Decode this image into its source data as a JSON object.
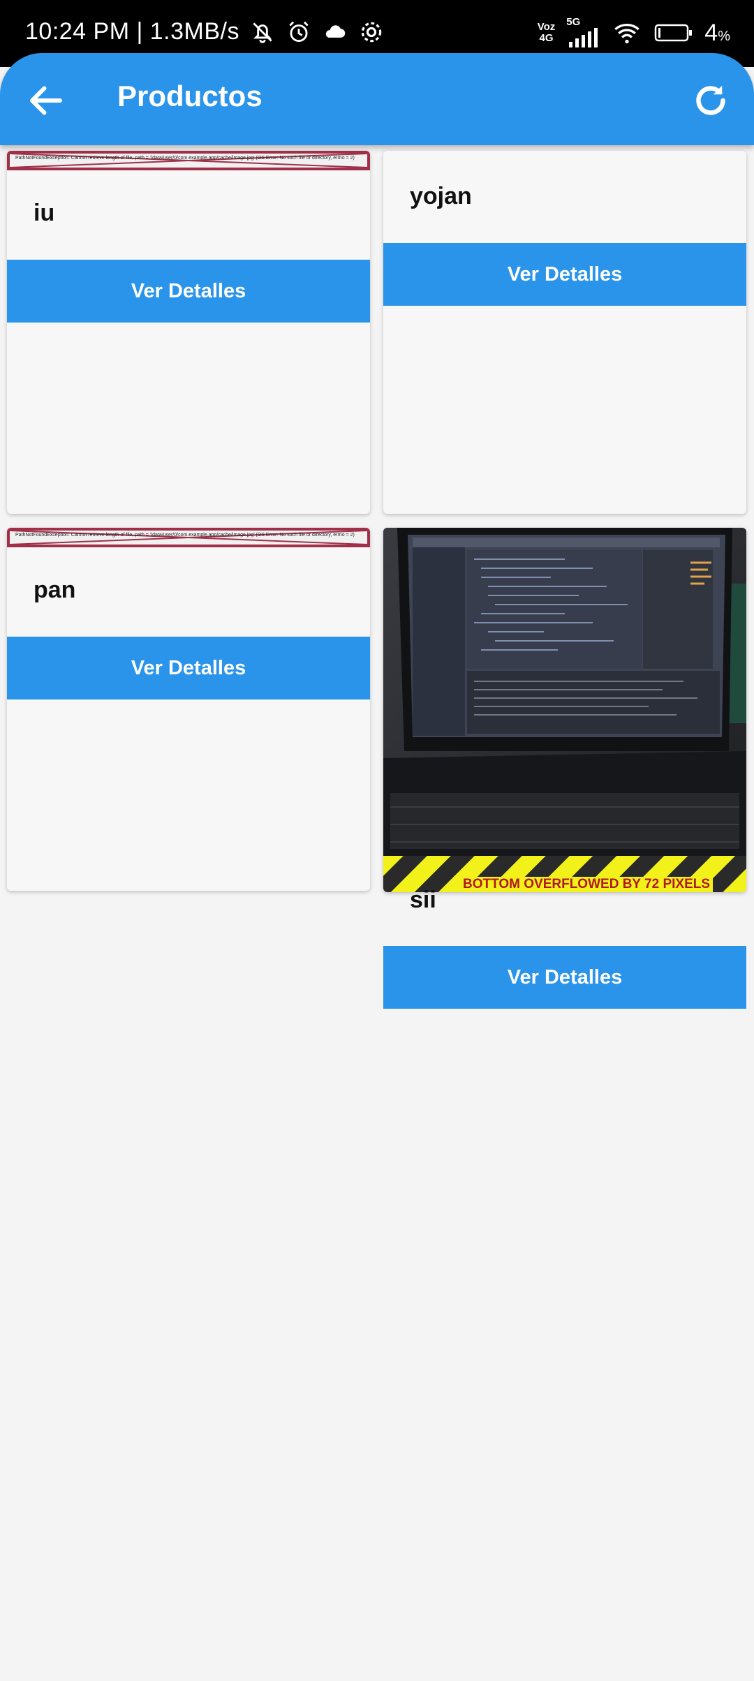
{
  "status_bar": {
    "time": "10:24 PM | 1.3MB/s",
    "network_top": "Voz",
    "network_bottom": "4G",
    "signal_type": "5G",
    "battery_pct": "4",
    "battery_unit": "%",
    "icons": [
      "bell-off-icon",
      "alarm-icon",
      "cloud-icon",
      "settings-gear-icon",
      "signal-icon",
      "wifi-icon",
      "battery-icon"
    ]
  },
  "appbar": {
    "title": "Productos",
    "back_icon": "arrow-back-icon",
    "refresh_icon": "refresh-icon",
    "color": "#2a94ea"
  },
  "products": [
    {
      "name": "iu",
      "button": "Ver Detalles",
      "image_error": "PathNotFoundException: Cannot retrieve length of file, path = '/data/user/0/com.example.app/cache/image.jpg' (OS Error: No such file or directory, errno = 2)"
    },
    {
      "name": "yojan",
      "button": "Ver Detalles"
    },
    {
      "name": "pan",
      "button": "Ver Detalles",
      "image_error": "PathNotFoundException: Cannot retrieve length of file, path = '/data/user/0/com.example.app/cache/image.jpg' (OS Error: No such file or directory, errno = 2)"
    },
    {
      "name": "sii",
      "button": "Ver Detalles",
      "overflow_warning": "BOTTOM OVERFLOWED BY 72 PIXELS"
    }
  ]
}
